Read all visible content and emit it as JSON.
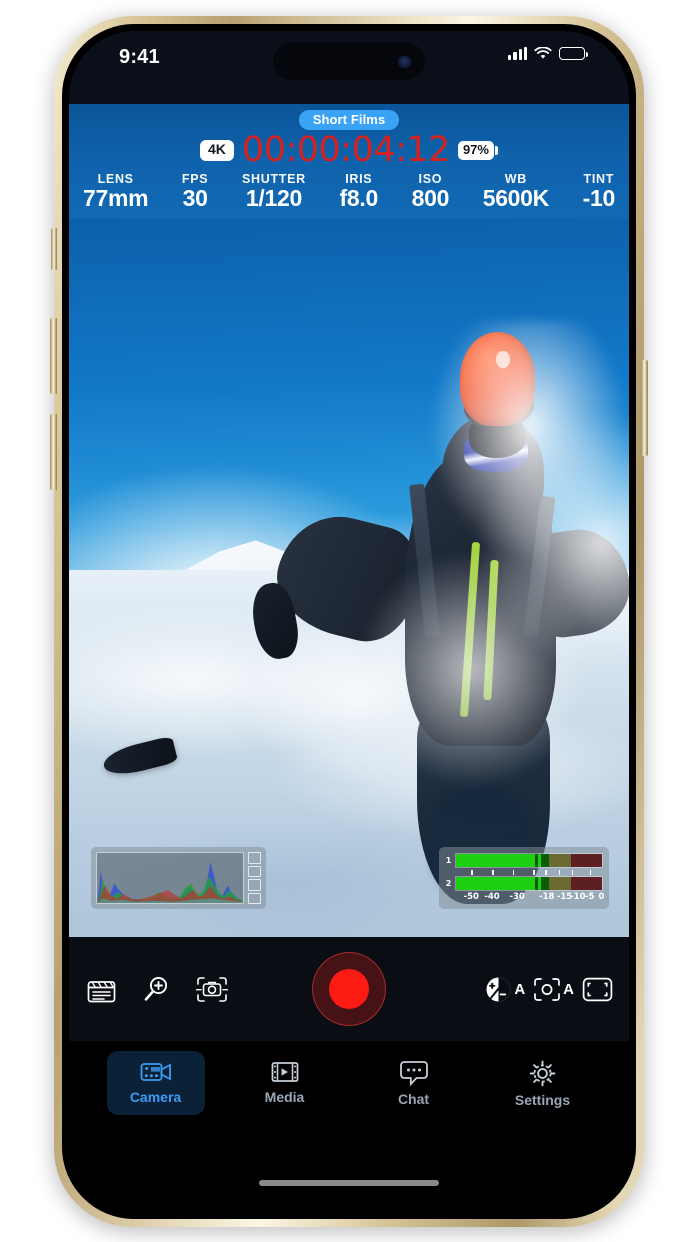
{
  "status_bar": {
    "time": "9:41",
    "cellular_icon": "signal-bars-icon",
    "wifi_icon": "wifi-icon",
    "battery_icon": "battery-icon"
  },
  "hud": {
    "project_badge": "Short Films",
    "resolution_chip": "4K",
    "timecode": "00:00:04:12",
    "battery_chip": "97%",
    "metadata": [
      {
        "key": "LENS",
        "value": "77mm"
      },
      {
        "key": "FPS",
        "value": "30"
      },
      {
        "key": "SHUTTER",
        "value": "1/120"
      },
      {
        "key": "IRIS",
        "value": "f8.0"
      },
      {
        "key": "ISO",
        "value": "800"
      },
      {
        "key": "WB",
        "value": "5600K"
      },
      {
        "key": "TINT",
        "value": "-10"
      }
    ]
  },
  "scopes": {
    "histogram_name": "rgb-histogram",
    "audio_meter": {
      "channels": [
        "1",
        "2"
      ],
      "scale_labels": [
        "-50",
        "-40",
        "-30",
        "-18",
        "-15",
        "-10",
        "-5",
        "0"
      ]
    }
  },
  "camera_toolbar": {
    "left_tools": [
      {
        "name": "clapperboard-slate-icon",
        "label": "Slate"
      },
      {
        "name": "zoom-magnifier-icon",
        "label": "Zoom"
      },
      {
        "name": "focus-frame-icon",
        "label": "Focus"
      }
    ],
    "record_button_label": "Record",
    "right_tools": [
      {
        "name": "exposure-compensation-icon",
        "mode": "A"
      },
      {
        "name": "focus-target-icon",
        "mode": "A"
      },
      {
        "name": "framing-guides-icon",
        "mode": ""
      }
    ]
  },
  "tab_bar": {
    "items": [
      {
        "label": "Camera",
        "icon": "video-camera-icon",
        "active": true
      },
      {
        "label": "Media",
        "icon": "film-strip-icon",
        "active": false
      },
      {
        "label": "Chat",
        "icon": "chat-bubble-icon",
        "active": false
      },
      {
        "label": "Settings",
        "icon": "gear-icon",
        "active": false
      }
    ]
  },
  "colors": {
    "record_red": "#fb1b13",
    "timecode_red": "#d6221f",
    "accent_blue": "#3d9bf5",
    "badge_blue": "#3aa3f5",
    "hud_blue": "#0f62ab",
    "tab_active_bg": "#0b2137"
  }
}
